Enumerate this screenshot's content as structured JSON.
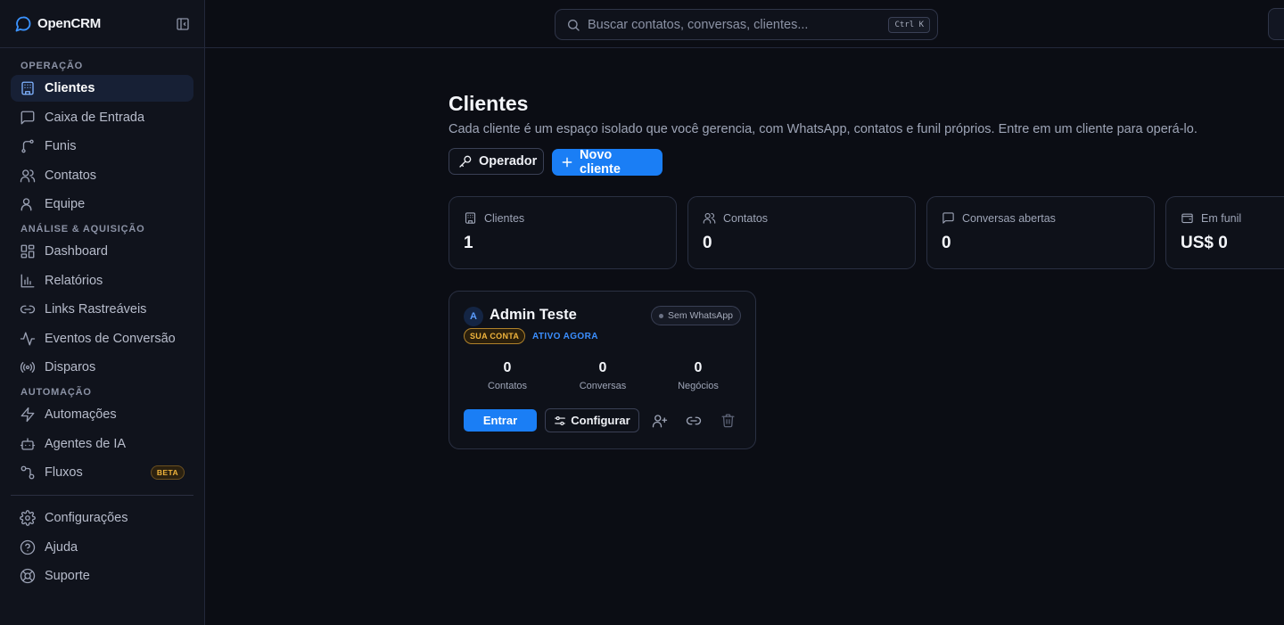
{
  "app": {
    "name": "OpenCRM"
  },
  "sidebar": {
    "sections": [
      {
        "label": "OPERAÇÃO"
      },
      {
        "label": "ANÁLISE & AQUISIÇÃO"
      },
      {
        "label": "AUTOMAÇÃO"
      }
    ],
    "items": [
      {
        "label": "Clientes",
        "icon": "building-icon"
      },
      {
        "label": "Caixa de Entrada",
        "icon": "message-square-icon"
      },
      {
        "label": "Funis",
        "icon": "git-branch-icon"
      },
      {
        "label": "Contatos",
        "icon": "users-icon"
      },
      {
        "label": "Equipe",
        "icon": "user-group-icon"
      },
      {
        "label": "Dashboard",
        "icon": "dashboard-grid-icon"
      },
      {
        "label": "Relatórios",
        "icon": "bar-chart-icon"
      },
      {
        "label": "Links Rastreáveis",
        "icon": "link-icon"
      },
      {
        "label": "Eventos de Conversão",
        "icon": "activity-icon"
      },
      {
        "label": "Disparos",
        "icon": "broadcast-icon"
      },
      {
        "label": "Automações",
        "icon": "zap-icon"
      },
      {
        "label": "Agentes de IA",
        "icon": "bot-icon"
      },
      {
        "label": "Fluxos",
        "icon": "workflow-icon",
        "badge": "BETA"
      }
    ],
    "footer_items": [
      {
        "label": "Configurações",
        "icon": "gear-icon"
      },
      {
        "label": "Ajuda",
        "icon": "help-circle-icon"
      },
      {
        "label": "Suporte",
        "icon": "lifebuoy-icon"
      }
    ]
  },
  "search": {
    "placeholder": "Buscar contatos, conversas, clientes...",
    "shortcut": "Ctrl K"
  },
  "page": {
    "title": "Clientes",
    "subtitle": "Cada cliente é um espaço isolado que você gerencia, com WhatsApp, contatos e funil próprios. Entre em um cliente para operá-lo.",
    "operator_label": "Operador",
    "new_client_label": "Novo cliente"
  },
  "stats": [
    {
      "label": "Clientes",
      "value": "1",
      "icon": "building-icon"
    },
    {
      "label": "Contatos",
      "value": "0",
      "icon": "users-icon"
    },
    {
      "label": "Conversas abertas",
      "value": "0",
      "icon": "message-square-icon"
    },
    {
      "label": "Em funil",
      "value": "US$ 0",
      "icon": "wallet-icon"
    }
  ],
  "client_card": {
    "avatar_letter": "A",
    "name": "Admin Teste",
    "whatsapp_status": "Sem WhatsApp",
    "own_badge": "SUA CONTA",
    "active_label": "ATIVO AGORA",
    "metrics": [
      {
        "value": "0",
        "label": "Contatos"
      },
      {
        "value": "0",
        "label": "Conversas"
      },
      {
        "value": "0",
        "label": "Negócios"
      }
    ],
    "enter_label": "Entrar",
    "configure_label": "Configurar"
  },
  "colors": {
    "accent": "#1a7ef5",
    "background": "#0b0d14",
    "sidebar": "#10131c",
    "badge_gold": "#f0b43c"
  }
}
